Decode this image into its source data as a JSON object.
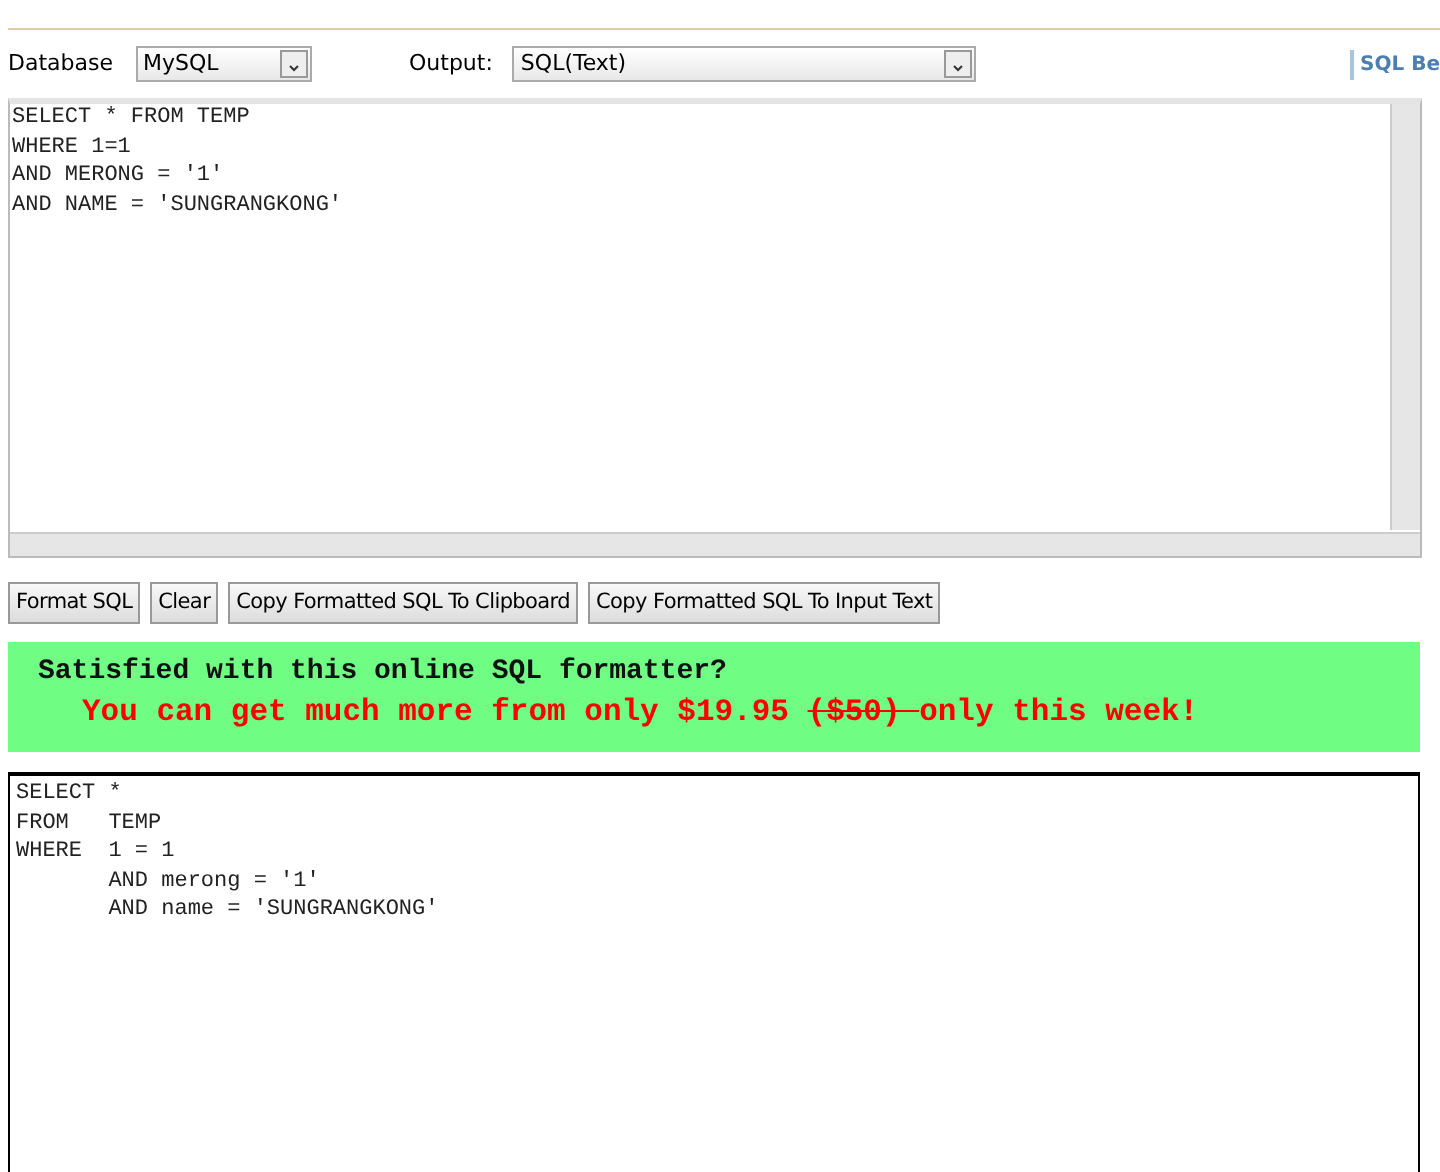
{
  "toolbar": {
    "database_label": "Database",
    "database_value": "MySQL",
    "output_label": "Output:",
    "output_value": "SQL(Text)",
    "link": "SQL Be"
  },
  "input_sql": [
    "SELECT * FROM TEMP",
    "WHERE 1=1",
    "AND MERONG = '1'",
    "AND NAME = 'SUNGRANGKONG'"
  ],
  "buttons": [
    "Format SQL",
    "Clear",
    "Copy Formatted SQL To Clipboard",
    "Copy Formatted SQL To Input Text"
  ],
  "promo": {
    "headline": "Satisfied with this online SQL formatter?",
    "segments": [
      {
        "text": "You can get much more from only $19.95 ",
        "struck": false
      },
      {
        "text": "($50) ",
        "struck": true
      },
      {
        "text": "only this week!",
        "struck": false
      }
    ]
  },
  "output_sql": [
    "SELECT *",
    "FROM   TEMP",
    "WHERE  1 = 1",
    "       AND merong = '1'",
    "       AND name = 'SUNGRANGKONG'"
  ]
}
